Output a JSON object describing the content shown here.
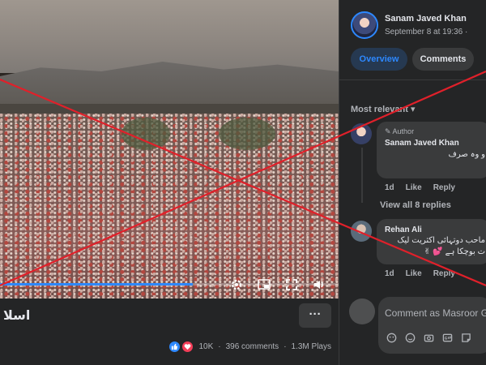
{
  "video": {
    "title": "اسلا",
    "progress": 0.57,
    "more_label": "···",
    "controls": [
      "settings-icon",
      "picture-in-picture-icon",
      "fullscreen-icon",
      "volume-icon"
    ]
  },
  "stats": {
    "reactions": "10K",
    "comments": "396 comments",
    "plays": "1.3M Plays"
  },
  "post": {
    "author": "Sanam Javed Khan",
    "date": "September 8 at 19:36 ·"
  },
  "tabs": [
    {
      "label": "Overview",
      "active": true
    },
    {
      "label": "Comments",
      "active": false
    }
  ],
  "sort": "Most relevant ▾",
  "comments": [
    {
      "badge": "✎ Author",
      "name": "Sanam Javed Khan",
      "text": "و وہ صرف",
      "actions": [
        "1d",
        "Like",
        "Reply"
      ],
      "view_replies": "View all 8 replies"
    },
    {
      "name": "Rehan Ali",
      "text_line1": "ماحب دوتہائی اکثریت لیک",
      "text_line2": "ت بوچکا ہے 💕 ✌",
      "actions": [
        "1d",
        "Like",
        "Reply"
      ]
    }
  ],
  "composer": {
    "placeholder": "Comment as Masroor G",
    "icons": [
      "sticker-icon",
      "emoji-icon",
      "camera-icon",
      "gif-icon",
      "stamp-icon"
    ]
  },
  "colors": {
    "accent": "#2d88ff",
    "overlay_x": "#e0202a"
  }
}
